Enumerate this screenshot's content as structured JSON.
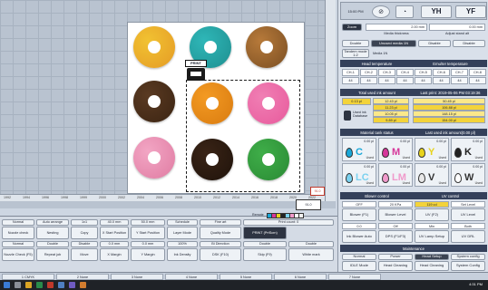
{
  "header": {
    "time": "15:00 PM",
    "yh": "YH",
    "yf": "YF"
  },
  "canvas": {
    "ruler_ticks": [
      "1992",
      "1994",
      "1996",
      "1998",
      "1999",
      "2000",
      "2002",
      "2004",
      "2006",
      "2008",
      "2010",
      "2012",
      "2014",
      "2016",
      "2018",
      "2020",
      "2022"
    ],
    "print_badge": "PRINT",
    "cursor_tag": "91.0",
    "position_box": "91.0"
  },
  "panel": {
    "zoom_label": "Zoom",
    "width_value": "2.00 mm",
    "media_thickness": "Media thickness",
    "width2_value": "0.00 mm",
    "adjust_label": "Adjust stand alt",
    "row2": [
      "Double",
      "Unused media 1N",
      "Disable",
      "Disable"
    ],
    "row3": [
      "Tandem mode 1:2",
      "Media 1N"
    ],
    "head_temp_hdr": "Head temperature",
    "env_temp_hdr": "Emu/ter temperature",
    "heads": [
      "CH-1",
      "CH-2",
      "CH-3",
      "CH-4",
      "CH-5",
      "CH-6",
      "CH-7",
      "CH-8"
    ],
    "head_vals": [
      "44",
      "44",
      "44",
      "44",
      "44",
      "44",
      "44",
      "44"
    ],
    "total_ink_hdr": "Total used ink amount",
    "last_print_hdr": "Last print: 2019-05-06 PM 03:19:36",
    "total_ink": "0.13 pl",
    "ink_rows": [
      "12.43 pl",
      "11.23 pl",
      "10.05 pl",
      "9.89 pl"
    ],
    "used_ink_label": "Used ink Database",
    "last_rows": [
      "50.45 pl",
      "106.88 pl",
      "148.15 pl",
      "154.00 pl"
    ],
    "material_hdr": "Material tank status",
    "last_used_hdr": "Last used ink amount(0.00 pl)",
    "inks": [
      {
        "letter": "C",
        "val": "0.00 pl",
        "used": "Used",
        "color": "#1aa7d8"
      },
      {
        "letter": "M",
        "val": "0.00 pl",
        "used": "Used",
        "color": "#d6379a"
      },
      {
        "letter": "Y",
        "val": "0.00 pl",
        "used": "Used",
        "color": "#e8d31c"
      },
      {
        "letter": "K",
        "val": "0.00 pl",
        "used": "Used",
        "color": "#222222"
      },
      {
        "letter": "LC",
        "val": "0.00 pl",
        "used": "Used",
        "color": "#7ad1ef"
      },
      {
        "letter": "LM",
        "val": "0.00 pl",
        "used": "Used",
        "color": "#f09acb"
      },
      {
        "letter": "V",
        "val": "0.00 pl",
        "used": "Used",
        "color": "#e8e8e8"
      },
      {
        "letter": "W",
        "val": "0.00 pl",
        "used": "Used",
        "color": "#ffffff"
      }
    ],
    "blower_hdr": "Blower control",
    "uv_hdr": "UV control",
    "blower_vals": [
      "OFF",
      "20 KPa",
      "119 cd",
      "Set Level"
    ],
    "blower_btns": [
      "Blower (F1)",
      "Blower Level",
      "UV (F2)",
      "UV Level"
    ],
    "dryer_vals": [
      "0.0",
      "Off",
      "Min",
      "Both"
    ],
    "dryer_btns": [
      "Ink Blower Auto",
      "DPS (F1/F3)",
      "UV Lamp Setup",
      "UV DRL"
    ],
    "maint_hdr": "Maintenance",
    "maint_row": [
      "Normal",
      "Power",
      "Head Setup",
      "System config"
    ],
    "maint_btns": [
      "IDLE Mode",
      "Head Cleaning",
      "Head Cleaning",
      "System Config"
    ]
  },
  "bottom": {
    "r1": [
      "Normal",
      "Auto arrange",
      "1x1",
      "40.0 mm",
      "50.0 mm",
      "Schedule",
      "Fine art",
      "Print count: 0"
    ],
    "r2": [
      "Nozzle check",
      "Nesting",
      "Copy",
      "X Start Position",
      "Y Start Position",
      "Layer Mode",
      "Quality Mode",
      "PRINT (PrtScrn)"
    ],
    "r3": [
      "Normal",
      "Double",
      "Disable",
      "0.0 mm",
      "0.0 mm",
      "100%",
      "Bi Direction",
      "Double",
      "Double"
    ],
    "r4": [
      "Nozzle Check (F5)",
      "Repeat job",
      "Move",
      "X Margin",
      "Y Margin",
      "Ink Density",
      "DSK (F10)",
      "Skip (F9)",
      "White mark"
    ],
    "swatches": [
      "#1aa7d8",
      "#d6379a",
      "#e8d31c",
      "#222222",
      "#7ad1ef",
      "#f09acb",
      "#ffffff",
      "#f2f2f2"
    ],
    "remote_label": "Remote"
  },
  "layers": [
    "1 CMYK",
    "2 None",
    "3 None",
    "4 None",
    "5 None",
    "6 None",
    "7 None"
  ],
  "taskbar": {
    "clock": "4:31 PM"
  }
}
